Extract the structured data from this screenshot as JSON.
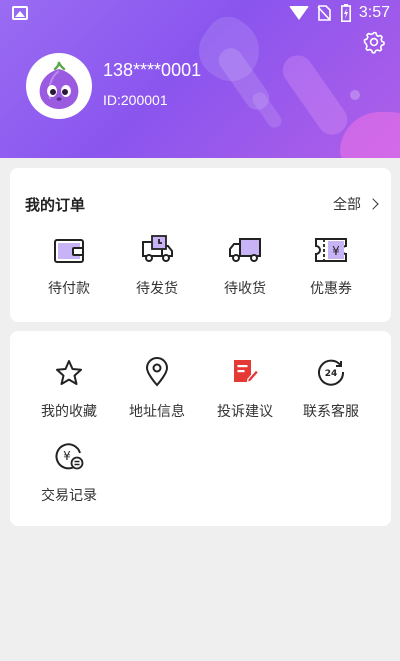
{
  "status_bar": {
    "time": "3:57"
  },
  "profile": {
    "phone": "138****0001",
    "user_id": "ID:200001"
  },
  "orders": {
    "title": "我的订单",
    "view_all": "全部",
    "items": [
      {
        "label": "待付款",
        "icon": "wallet-icon"
      },
      {
        "label": "待发货",
        "icon": "truck-clock-icon"
      },
      {
        "label": "待收货",
        "icon": "truck-icon"
      },
      {
        "label": "优惠券",
        "icon": "coupon-icon"
      }
    ]
  },
  "services": {
    "items": [
      {
        "label": "我的收藏",
        "icon": "star-icon"
      },
      {
        "label": "地址信息",
        "icon": "location-pin-icon"
      },
      {
        "label": "投诉建议",
        "icon": "feedback-icon"
      },
      {
        "label": "联系客服",
        "icon": "clock-24-icon"
      },
      {
        "label": "交易记录",
        "icon": "yuan-record-icon"
      }
    ]
  },
  "colors": {
    "header_gradient_start": "#9a6cf3",
    "header_gradient_end": "#b05fe8",
    "accent_purple": "#8b5cf6",
    "feedback_red": "#e53935",
    "background": "#efefef"
  }
}
